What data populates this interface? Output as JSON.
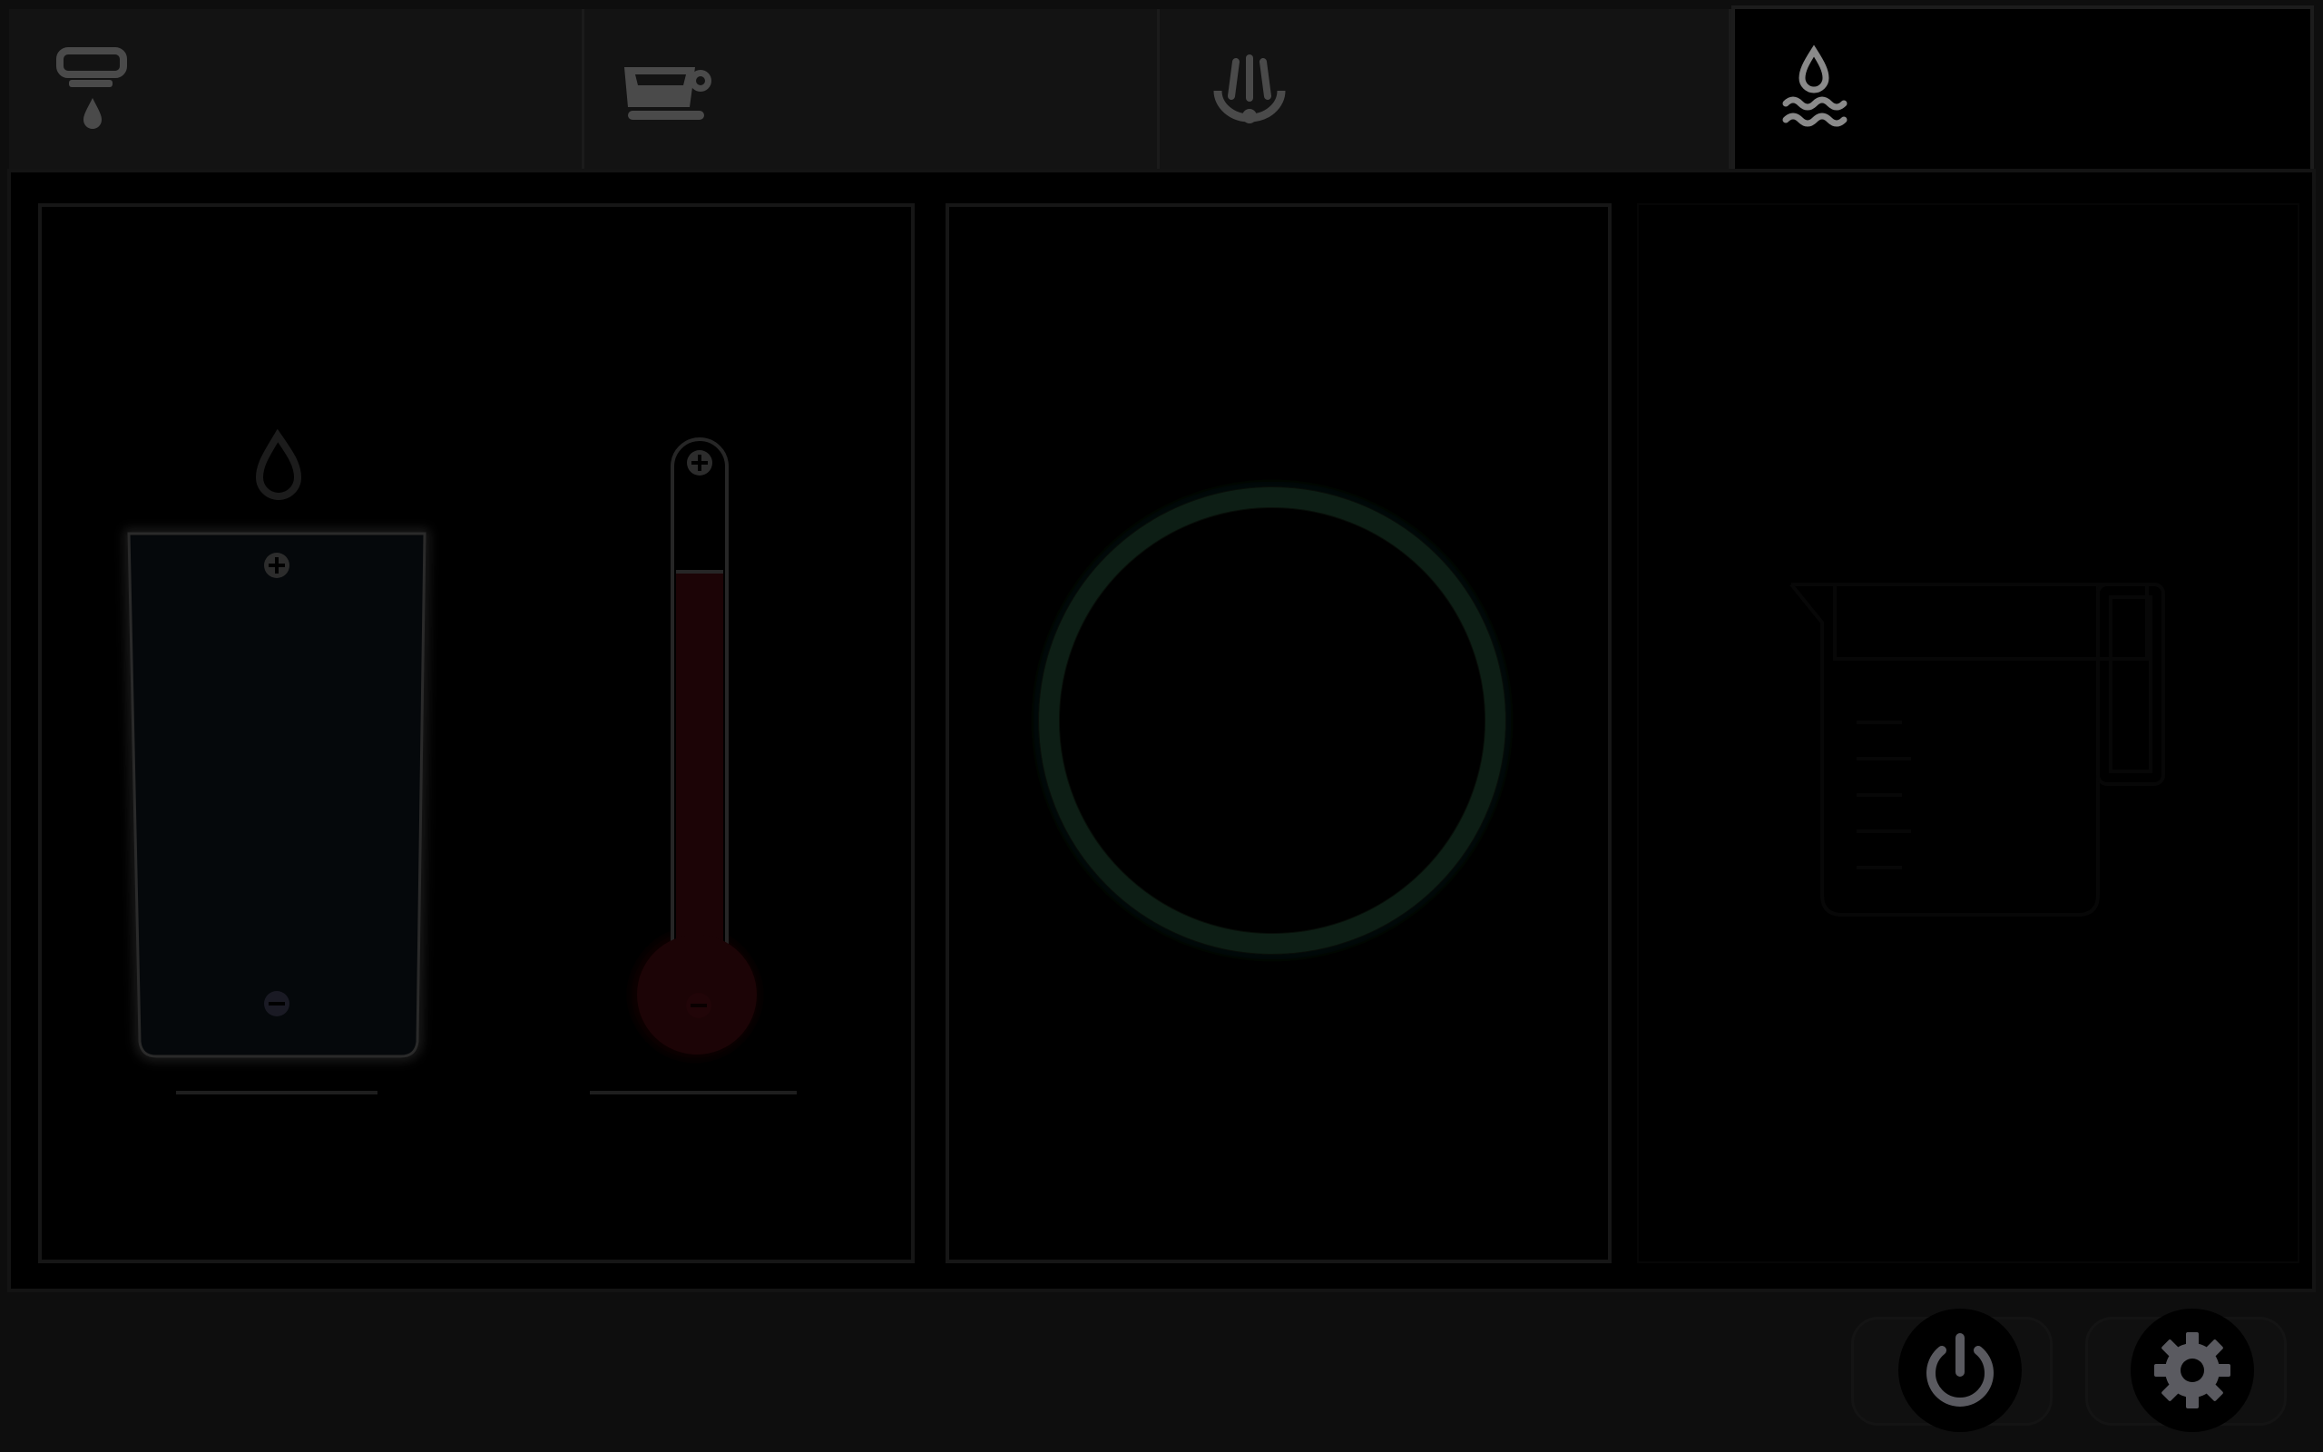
{
  "tabs": [
    {
      "id": "dispense",
      "icon": "drip-dispense-icon",
      "active": false
    },
    {
      "id": "coffee",
      "icon": "coffee-cup-icon",
      "active": false
    },
    {
      "id": "steam",
      "icon": "steam-wand-icon",
      "active": false
    },
    {
      "id": "hot-water",
      "icon": "hot-water-icon",
      "active": true
    }
  ],
  "controls": {
    "volume_cup": {
      "icon": "water-drop-icon",
      "increase": "plus-icon",
      "decrease": "minus-icon"
    },
    "temperature": {
      "icon": "thermometer-icon",
      "increase": "plus-icon",
      "decrease": "minus-icon"
    },
    "start_ring": {
      "icon": "start-ring-icon"
    },
    "pitcher": {
      "icon": "measuring-pitcher-icon"
    }
  },
  "colors": {
    "accent_green": "#0d1e15",
    "temperature_red": "#1c0406",
    "inactive_icon": "#4a4a4a",
    "active_icon": "#8a8a8a",
    "footer_icon": "#5a5a60"
  },
  "footer": {
    "power": {
      "icon": "power-icon"
    },
    "settings": {
      "icon": "gear-icon"
    }
  }
}
